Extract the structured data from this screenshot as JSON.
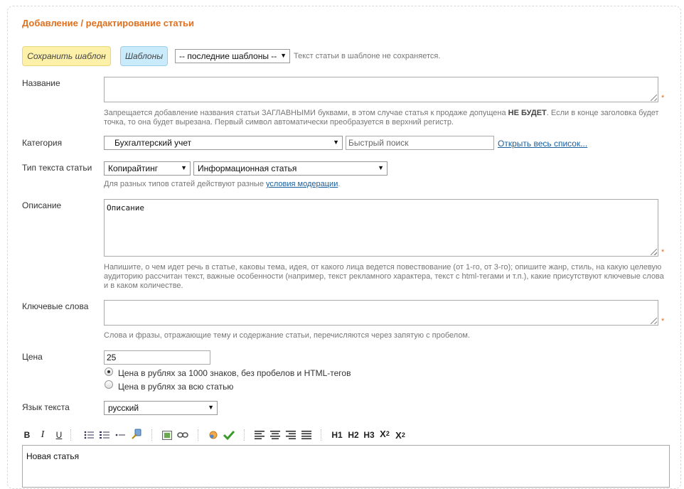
{
  "form": {
    "title": "Добавление / редактирование статьи",
    "template_bar": {
      "save_label": "Сохранить шаблон",
      "templates_label": "Шаблоны",
      "recent_select": "-- последние шаблоны --",
      "note": "Текст статьи в шаблоне не сохраняется."
    },
    "name": {
      "label": "Название",
      "value": "",
      "note_pre": "Запрещается добавление названия статьи ЗАГЛАВНЫМИ буквами, в этом случае статья к продаже допущена ",
      "note_bold": "НЕ БУДЕТ",
      "note_post": ". Если в конце заголовка будет",
      "note_line2": "точка, то она будет вырезана. Первый символ автоматически преобразуется в верхний регистр."
    },
    "category": {
      "label": "Категория",
      "selected": "Бухгалтерский учет",
      "search_placeholder": "Быстрый поиск",
      "open_list": "Открыть весь список..."
    },
    "text_type": {
      "label": "Тип текста статьи",
      "kind": "Копирайтинг",
      "subtype": "Информационная статья",
      "note_pre": "Для разных типов статей действуют разные ",
      "note_link": "условия модерации",
      "note_post": "."
    },
    "description": {
      "label": "Описание",
      "value": "Описание",
      "note_line1": "Напишите, о чем идет речь в статье, каковы тема, идея, от какого лица ведется повествование (от 1-го, от 3-го); опишите жанр, стиль, на какую целевую",
      "note_line2": "аудиторию рассчитан текст, важные особенности (например, текст рекламного характера, текст с html-тегами и т.п.), какие присутствуют ключевые слова",
      "note_line3": "и в каком количестве."
    },
    "keywords": {
      "label": "Ключевые слова",
      "value": "",
      "note": "Слова и фразы, отражающие тему и содержание статьи, перечисляются через запятую с пробелом."
    },
    "price": {
      "label": "Цена",
      "value": "25",
      "option1": "Цена в рублях за 1000 знаков, без пробелов и HTML-тегов",
      "option2": "Цена в рублях за всю статью"
    },
    "language": {
      "label": "Язык текста",
      "selected": "русский"
    },
    "required_mark": "*",
    "toolbar": {
      "bold": "B",
      "italic": "I",
      "underline": "U",
      "h1": "H1",
      "h2": "H2",
      "h3": "H3",
      "sup": "X",
      "sup_mark": "2",
      "sub": "X",
      "sub_mark": "2"
    },
    "editor": {
      "value": "Новая статья"
    }
  }
}
